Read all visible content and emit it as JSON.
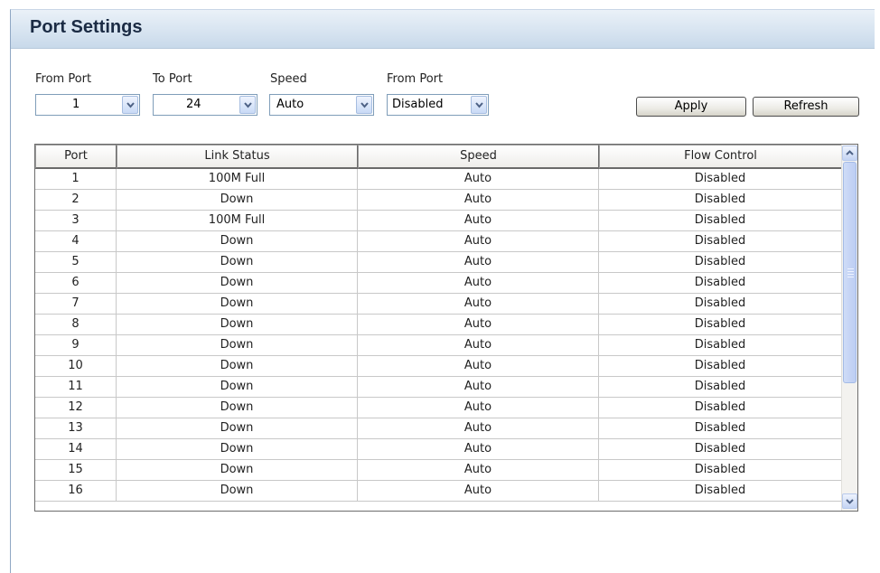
{
  "title": "Port Settings",
  "filters": {
    "from_port": {
      "label": "From Port",
      "value": "1"
    },
    "to_port": {
      "label": "To Port",
      "value": "24"
    },
    "speed": {
      "label": "Speed",
      "value": "Auto"
    },
    "flow": {
      "label": "From Port",
      "value": "Disabled"
    }
  },
  "buttons": {
    "apply": "Apply",
    "refresh": "Refresh"
  },
  "table": {
    "headers": [
      "Port",
      "Link Status",
      "Speed",
      "Flow Control"
    ],
    "rows": [
      [
        "1",
        "100M Full",
        "Auto",
        "Disabled"
      ],
      [
        "2",
        "Down",
        "Auto",
        "Disabled"
      ],
      [
        "3",
        "100M Full",
        "Auto",
        "Disabled"
      ],
      [
        "4",
        "Down",
        "Auto",
        "Disabled"
      ],
      [
        "5",
        "Down",
        "Auto",
        "Disabled"
      ],
      [
        "6",
        "Down",
        "Auto",
        "Disabled"
      ],
      [
        "7",
        "Down",
        "Auto",
        "Disabled"
      ],
      [
        "8",
        "Down",
        "Auto",
        "Disabled"
      ],
      [
        "9",
        "Down",
        "Auto",
        "Disabled"
      ],
      [
        "10",
        "Down",
        "Auto",
        "Disabled"
      ],
      [
        "11",
        "Down",
        "Auto",
        "Disabled"
      ],
      [
        "12",
        "Down",
        "Auto",
        "Disabled"
      ],
      [
        "13",
        "Down",
        "Auto",
        "Disabled"
      ],
      [
        "14",
        "Down",
        "Auto",
        "Disabled"
      ],
      [
        "15",
        "Down",
        "Auto",
        "Disabled"
      ],
      [
        "16",
        "Down",
        "Auto",
        "Disabled"
      ]
    ]
  },
  "icons": {
    "dropdown": "chevron-down-icon",
    "scroll_up": "arrow-up-icon",
    "scroll_down": "arrow-down-icon"
  }
}
